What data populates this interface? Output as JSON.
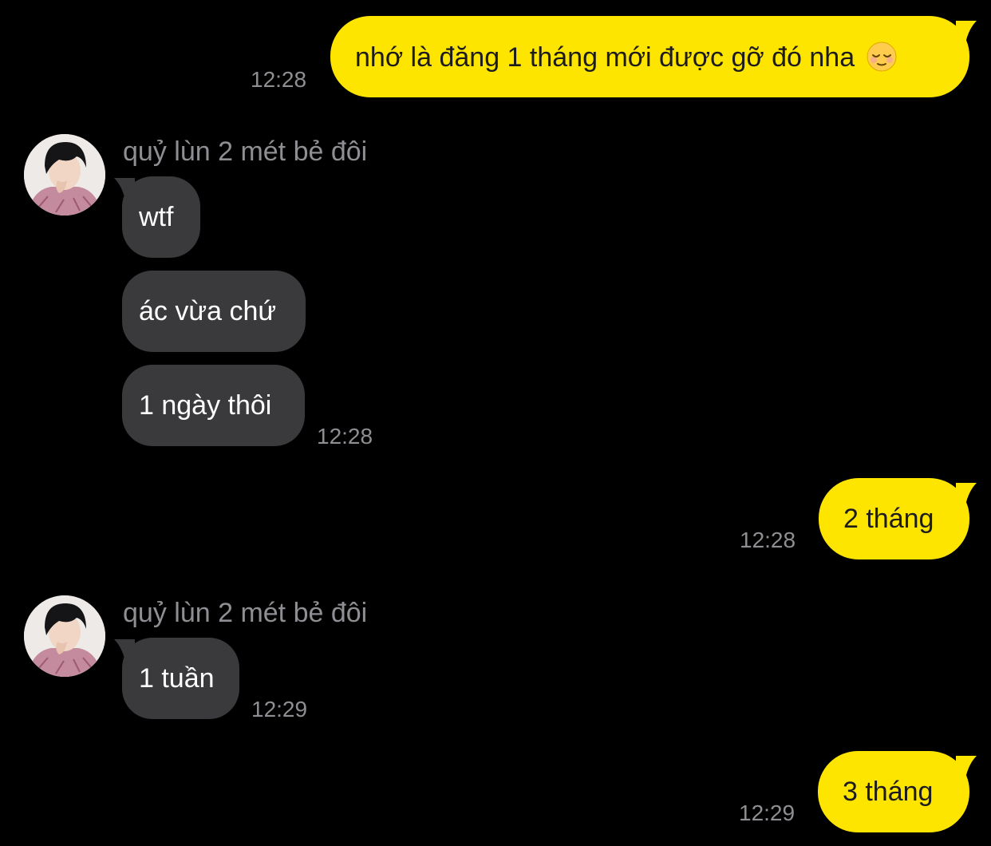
{
  "colors": {
    "background": "#000000",
    "outgoing_bubble": "#FEE500",
    "incoming_bubble": "#3a3a3c",
    "timestamp": "#8e8e93"
  },
  "contact": {
    "name": "quỷ lùn 2 mét bẻ đôi",
    "avatar_icon": "profile-photo"
  },
  "messages": [
    {
      "from": "me",
      "text": "nhớ là đăng 1 tháng mới được gỡ đó nha",
      "emoji": "relieved-face-emoji",
      "time": "12:28"
    },
    {
      "from": "contact",
      "text": "wtf"
    },
    {
      "from": "contact",
      "text": "ác vừa chứ"
    },
    {
      "from": "contact",
      "text": "1 ngày thôi",
      "time": "12:28"
    },
    {
      "from": "me",
      "text": "2 tháng",
      "time": "12:28"
    },
    {
      "from": "contact",
      "text": "1 tuần",
      "time": "12:29"
    },
    {
      "from": "me",
      "text": "3 tháng",
      "time": "12:29"
    }
  ]
}
